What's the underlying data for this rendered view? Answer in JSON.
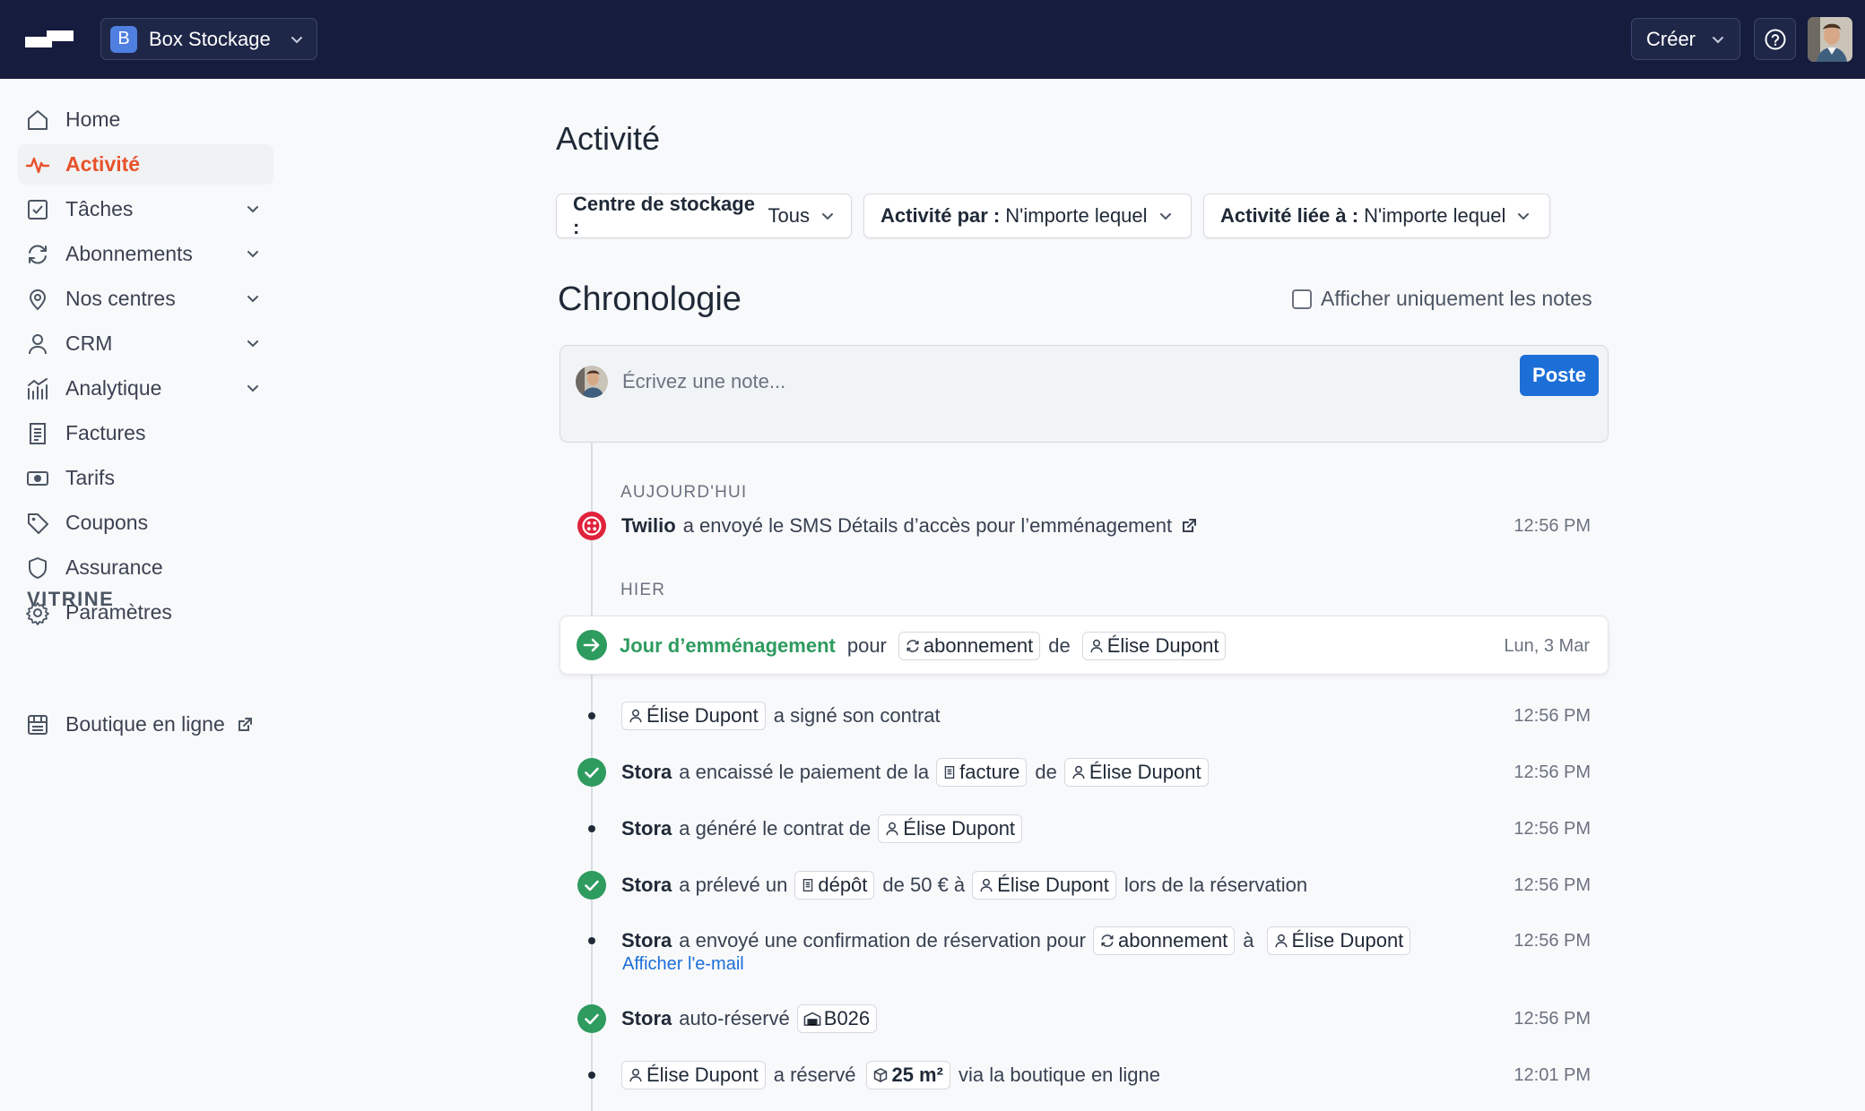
{
  "topbar": {
    "store_initial": "B",
    "store_name": "Box Stockage",
    "create_label": "Créer"
  },
  "sidebar": {
    "items": [
      {
        "label": "Home"
      },
      {
        "label": "Activité"
      },
      {
        "label": "Tâches"
      },
      {
        "label": "Abonnements"
      },
      {
        "label": "Nos centres"
      },
      {
        "label": "CRM"
      },
      {
        "label": "Analytique"
      },
      {
        "label": "Factures"
      },
      {
        "label": "Tarifs"
      },
      {
        "label": "Coupons"
      },
      {
        "label": "Assurance"
      },
      {
        "label": "Paramètres"
      }
    ],
    "section_label": "VITRINE",
    "shop_label": "Boutique en ligne"
  },
  "main": {
    "title": "Activité",
    "filters": [
      {
        "label": "Centre de stockage :",
        "value": "Tous"
      },
      {
        "label": "Activité par :",
        "value": "N'importe lequel"
      },
      {
        "label": "Activité liée à :",
        "value": "N'importe lequel"
      }
    ],
    "timeline_title": "Chronologie",
    "notes_only_label": "Afficher uniquement les notes",
    "note_placeholder": "Écrivez une note...",
    "post_label": "Poste"
  },
  "timeline": {
    "today_label": "AUJOURD'HUI",
    "yesterday_label": "HIER",
    "twilio": {
      "actor": "Twilio",
      "text": "a envoyé le SMS Détails d’accès pour l’emménagement",
      "time": "12:56 PM"
    },
    "move_in": {
      "title": "Jour d’emménagement",
      "for": "pour",
      "subscription": "abonnement",
      "of": "de",
      "customer": "Élise Dupont",
      "date": "Lun, 3 Mar"
    },
    "e1": {
      "customer": "Élise Dupont",
      "text": "a signé son contrat",
      "time": "12:56 PM"
    },
    "e2": {
      "actor": "Stora",
      "text": "a encaissé le paiement de la",
      "invoice": "facture",
      "of": "de",
      "customer": "Élise Dupont",
      "time": "12:56 PM"
    },
    "e3": {
      "actor": "Stora",
      "text": "a généré le contrat de",
      "customer": "Élise Dupont",
      "time": "12:56 PM"
    },
    "e4": {
      "actor": "Stora",
      "text": "a prélevé un",
      "deposit": "dépôt",
      "amount": "de 50 € à",
      "customer": "Élise Dupont",
      "suffix": "lors de la réservation",
      "time": "12:56 PM"
    },
    "e5": {
      "actor": "Stora",
      "text": "a envoyé une confirmation de réservation pour",
      "subscription": "abonnement",
      "to": "à",
      "customer": "Élise Dupont",
      "link": "Afficher l'e-mail",
      "time": "12:56 PM"
    },
    "e6": {
      "actor": "Stora",
      "text": "auto-réservé",
      "unit": "B026",
      "time": "12:56 PM"
    },
    "e7": {
      "customer": "Élise Dupont",
      "text": "a réservé",
      "size": "25 m²",
      "suffix": "via la boutique en ligne",
      "time": "12:01 PM"
    }
  },
  "colors": {
    "topbar": "#151c3d",
    "accent": "#e8522b",
    "primary": "#1d6fd8",
    "success": "#2e9b5f",
    "twilio": "#e0223b"
  },
  "icons": [
    "logo-icon",
    "chevron-down-icon",
    "help-icon",
    "home-icon",
    "activity-icon",
    "tasks-icon",
    "subscriptions-icon",
    "location-icon",
    "user-icon",
    "analytics-icon",
    "invoice-icon",
    "pricing-icon",
    "tag-icon",
    "shield-icon",
    "gear-icon",
    "store-icon",
    "external-link-icon",
    "twilio-icon",
    "arrow-right-icon",
    "check-icon",
    "unit-icon",
    "box-icon"
  ]
}
